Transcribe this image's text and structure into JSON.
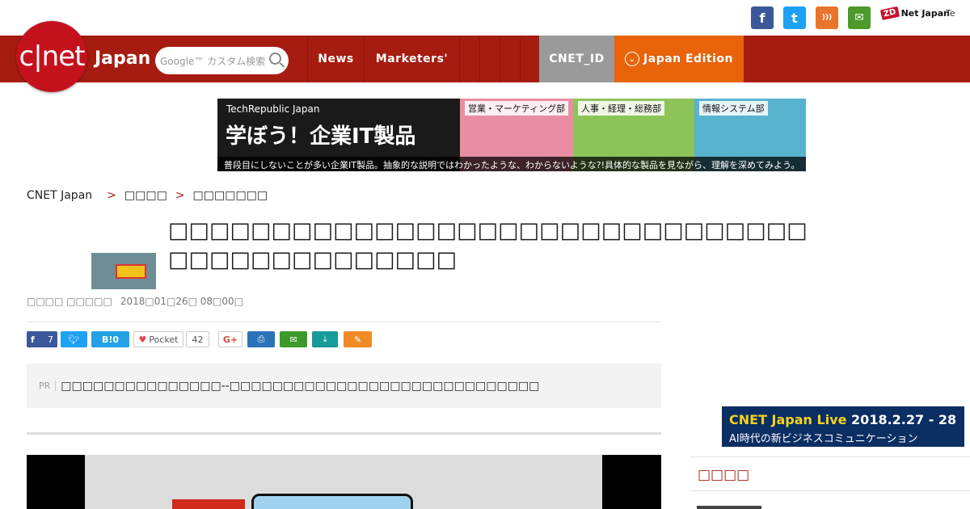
{
  "social": {
    "facebook": "f",
    "twitter": "t",
    "rss": "rss",
    "mail": "mail",
    "zdnet_badge": "ZD",
    "zdnet_label": "Net Japan",
    "techrepublic": "Te"
  },
  "header": {
    "logo_text": "c|net",
    "logo_region": "Japan",
    "search_placeholder": "Google™ カスタム検索",
    "nav": [
      "News",
      "Marketers'",
      "",
      "",
      "",
      ""
    ],
    "cnet_id": "CNET_ID",
    "edition": "Japan Edition"
  },
  "banner": {
    "brand": "TechRepublic Japan",
    "headline": "学ぼう！企業IT製品",
    "dept1": "営業・マーケティング部",
    "dept2": "人事・経理・総務部",
    "dept3": "情報システム部",
    "sub": "普段目にしないことが多い企業IT製品。抽象的な説明ではわかったような、わからないような?!具体的な製品を見ながら、理解を深めてみよう。"
  },
  "breadcrumb": [
    "CNET Japan",
    ">",
    "□□□□",
    ">",
    "□□□□□□□"
  ],
  "article": {
    "headline": "□□□□□□□□□□□□□□□□□□□□□□□□□□□□□□□ □□□□□□□□□□□□□□",
    "author": "□□□□ □□□□□",
    "date": "2018□01□26□ 08□00□"
  },
  "share": {
    "facebook_count": "7",
    "hatena_label": "B!0",
    "pocket_label": "Pocket",
    "pocket_count": "42",
    "gplus": "G+"
  },
  "pr": {
    "tag": "PR",
    "text": "□□□□□□□□□□□□□□□--□□□□□□□□□□□□□□□□□□□□□□□□□□□□□"
  },
  "sidebar": {
    "live_title": "CNET Japan Live",
    "live_date": "2018.2.27 - 28",
    "live_sub": "AI時代の新ビジネスコミュニケーション",
    "section_heading": "□□□□"
  }
}
